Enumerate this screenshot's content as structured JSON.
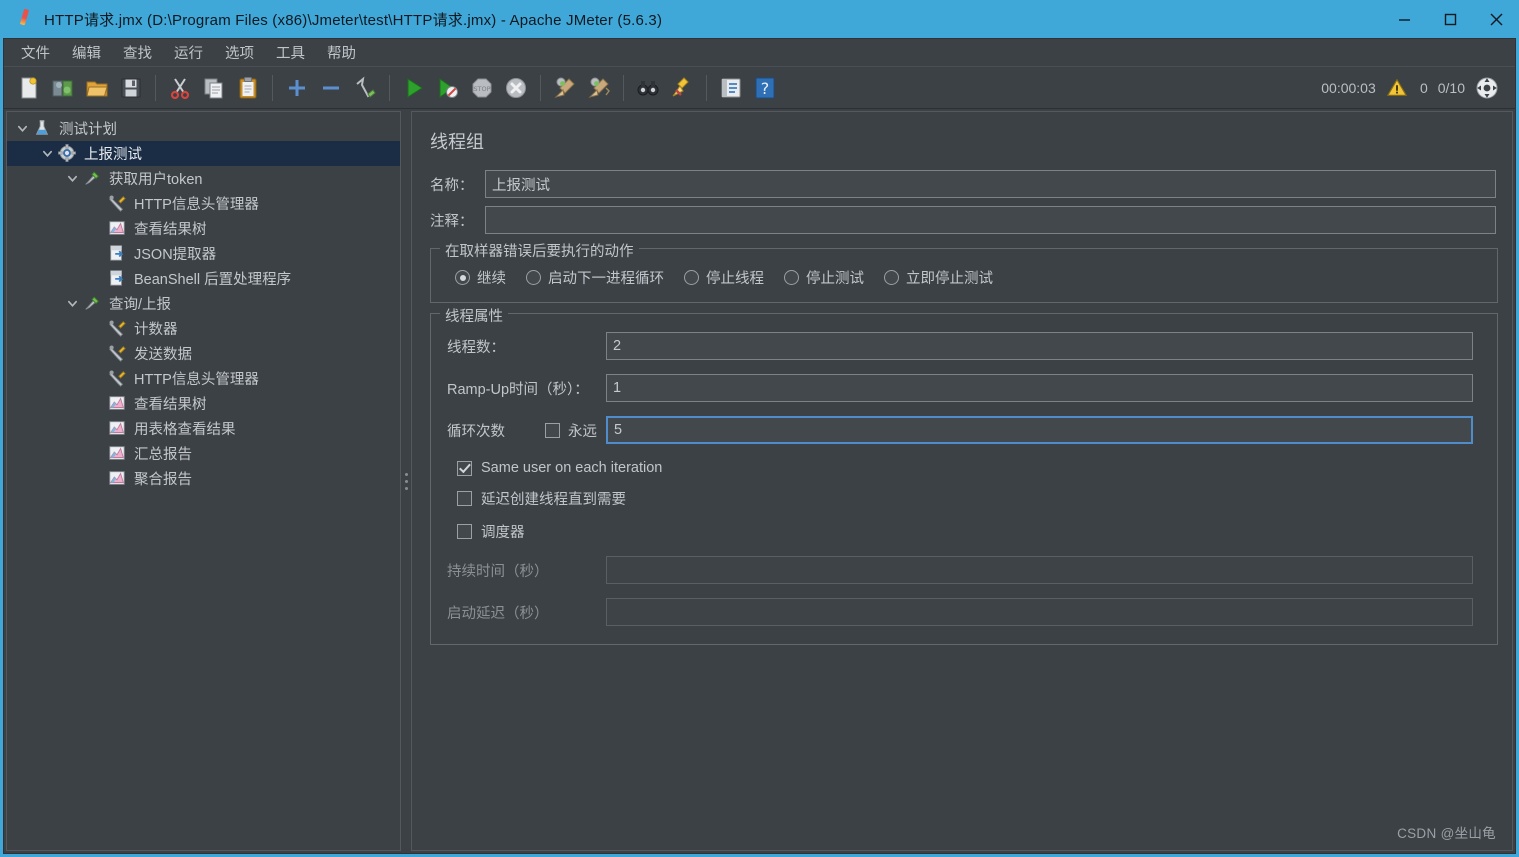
{
  "window": {
    "title": "HTTP请求.jmx (D:\\Program Files (x86)\\Jmeter\\test\\HTTP请求.jmx) - Apache JMeter (5.6.3)",
    "app_icon": "jmeter-feather-icon",
    "minimize_label": "Minimize",
    "maximize_label": "Maximize",
    "close_label": "Close",
    "titlebar_color": "#3fa8d8",
    "background_color": "#3c4145"
  },
  "menubar": {
    "items": [
      {
        "label": "文件",
        "name": "menu-file"
      },
      {
        "label": "编辑",
        "name": "menu-edit"
      },
      {
        "label": "查找",
        "name": "menu-search"
      },
      {
        "label": "运行",
        "name": "menu-run"
      },
      {
        "label": "选项",
        "name": "menu-options"
      },
      {
        "label": "工具",
        "name": "menu-tools"
      },
      {
        "label": "帮助",
        "name": "menu-help"
      }
    ]
  },
  "toolbar": {
    "buttons": [
      {
        "icon": "new-file-icon",
        "tooltip": "新建"
      },
      {
        "icon": "templates-icon",
        "tooltip": "模板"
      },
      {
        "icon": "open-folder-icon",
        "tooltip": "打开"
      },
      {
        "icon": "save-icon",
        "tooltip": "保存"
      },
      {
        "sep": true
      },
      {
        "icon": "cut-scissors-icon",
        "tooltip": "剪切"
      },
      {
        "icon": "copy-icon",
        "tooltip": "复制"
      },
      {
        "icon": "paste-clipboard-icon",
        "tooltip": "粘贴"
      },
      {
        "sep": true
      },
      {
        "icon": "expand-plus-icon",
        "tooltip": "展开全部"
      },
      {
        "icon": "collapse-minus-icon",
        "tooltip": "收起全部"
      },
      {
        "icon": "toggle-pencil-icon",
        "tooltip": "切换启用"
      },
      {
        "sep": true
      },
      {
        "icon": "start-play-icon",
        "tooltip": "启动"
      },
      {
        "icon": "start-no-pauses-icon",
        "tooltip": "无暂停启动"
      },
      {
        "icon": "stop-sign-icon",
        "tooltip": "停止"
      },
      {
        "icon": "shutdown-x-icon",
        "tooltip": "关闭"
      },
      {
        "sep": true
      },
      {
        "icon": "clear-broom-icon",
        "tooltip": "清除"
      },
      {
        "icon": "clear-all-broom-icon",
        "tooltip": "清除全部"
      },
      {
        "sep": true
      },
      {
        "icon": "search-binoculars-icon",
        "tooltip": "搜索"
      },
      {
        "icon": "search-reset-broom-icon",
        "tooltip": "重置搜索"
      },
      {
        "sep": true
      },
      {
        "icon": "function-helper-icon",
        "tooltip": "函数助手"
      },
      {
        "icon": "help-question-icon",
        "tooltip": "帮助"
      }
    ],
    "status": {
      "elapsed": "00:00:03",
      "warning_icon": "warning-triangle-icon",
      "error_count": "0",
      "threads": "0/10",
      "threads_icon": "thread-status-icon"
    }
  },
  "tree": {
    "nodes": [
      {
        "label": "测试计划",
        "icon": "flask-icon",
        "depth": 0,
        "twisty": "expanded",
        "selected": false
      },
      {
        "label": "上报测试",
        "icon": "gear-icon",
        "depth": 1,
        "twisty": "expanded",
        "selected": true
      },
      {
        "label": "获取用户token",
        "icon": "sampler-pin-icon",
        "depth": 2,
        "twisty": "expanded",
        "selected": false
      },
      {
        "label": "HTTP信息头管理器",
        "icon": "config-tools-icon",
        "depth": 3,
        "twisty": "none",
        "selected": false
      },
      {
        "label": "查看结果树",
        "icon": "listener-chart-icon",
        "depth": 3,
        "twisty": "none",
        "selected": false
      },
      {
        "label": "JSON提取器",
        "icon": "postprocessor-icon",
        "depth": 3,
        "twisty": "none",
        "selected": false
      },
      {
        "label": "BeanShell 后置处理程序",
        "icon": "postprocessor-icon",
        "depth": 3,
        "twisty": "none",
        "selected": false
      },
      {
        "label": "查询/上报",
        "icon": "sampler-pin-icon",
        "depth": 2,
        "twisty": "expanded",
        "selected": false
      },
      {
        "label": "计数器",
        "icon": "config-tools-icon",
        "depth": 3,
        "twisty": "none",
        "selected": false
      },
      {
        "label": "发送数据",
        "icon": "config-tools-icon",
        "depth": 3,
        "twisty": "none",
        "selected": false
      },
      {
        "label": "HTTP信息头管理器",
        "icon": "config-tools-icon",
        "depth": 3,
        "twisty": "none",
        "selected": false
      },
      {
        "label": "查看结果树",
        "icon": "listener-chart-icon",
        "depth": 3,
        "twisty": "none",
        "selected": false
      },
      {
        "label": "用表格查看结果",
        "icon": "listener-chart-icon",
        "depth": 3,
        "twisty": "none",
        "selected": false
      },
      {
        "label": "汇总报告",
        "icon": "listener-chart-icon",
        "depth": 3,
        "twisty": "none",
        "selected": false
      },
      {
        "label": "聚合报告",
        "icon": "listener-chart-icon",
        "depth": 3,
        "twisty": "none",
        "selected": false
      }
    ]
  },
  "panel": {
    "title": "线程组",
    "name_label": "名称：",
    "name_value": "上报测试",
    "comment_label": "注释：",
    "comment_value": "",
    "on_error": {
      "legend": "在取样器错误后要执行的动作",
      "options": [
        {
          "label": "继续",
          "selected": true
        },
        {
          "label": "启动下一进程循环",
          "selected": false
        },
        {
          "label": "停止线程",
          "selected": false
        },
        {
          "label": "停止测试",
          "selected": false
        },
        {
          "label": "立即停止测试",
          "selected": false
        }
      ]
    },
    "thread_props": {
      "legend": "线程属性",
      "threads_label": "线程数：",
      "threads_value": "2",
      "rampup_label": "Ramp-Up时间（秒）：",
      "rampup_value": "1",
      "loops_label": "循环次数",
      "forever_label": "永远",
      "forever_checked": false,
      "loops_value": "5",
      "loops_focused": true,
      "same_user_label": "Same user on each iteration",
      "same_user_checked": true,
      "delay_create_label": "延迟创建线程直到需要",
      "delay_create_checked": false,
      "scheduler_label": "调度器",
      "scheduler_checked": false,
      "duration_label": "持续时间（秒）",
      "duration_value": "",
      "duration_disabled": true,
      "startup_delay_label": "启动延迟（秒）",
      "startup_delay_value": "",
      "startup_delay_disabled": true
    }
  },
  "watermark": "CSDN @坐山龟"
}
